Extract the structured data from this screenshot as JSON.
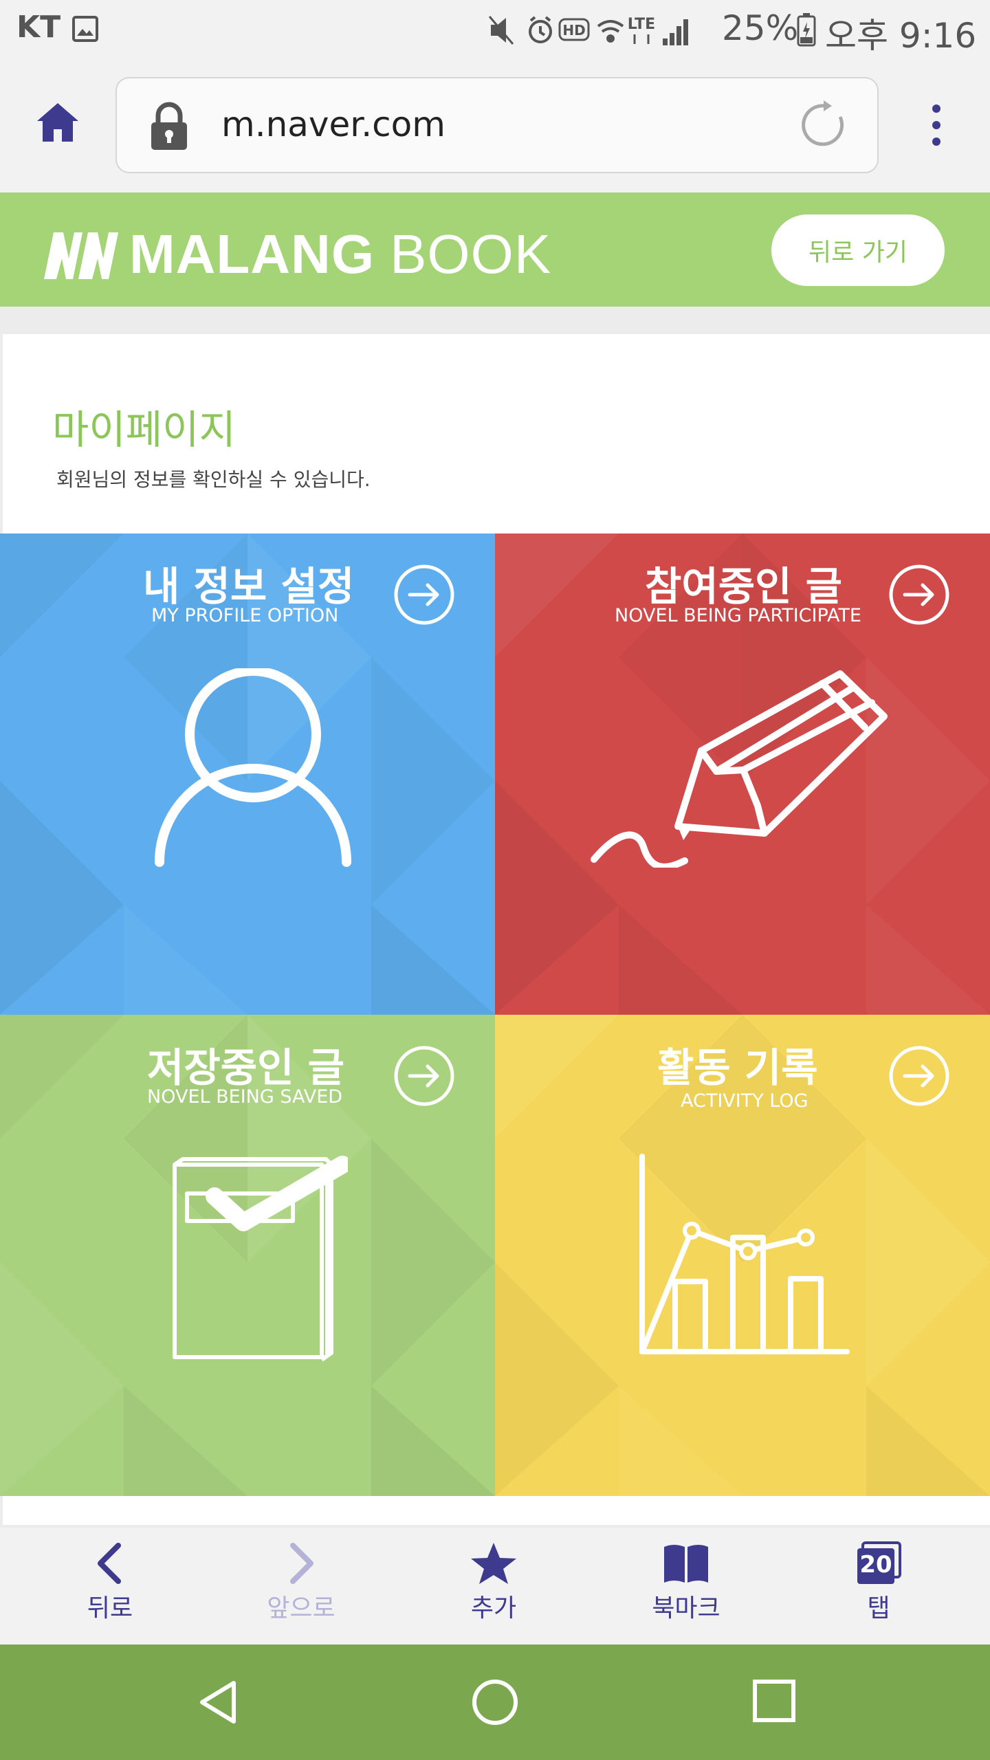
{
  "status_bar": {
    "carrier": "KT",
    "battery_percent": "25%",
    "time": "오후 9:16",
    "network": "LTE"
  },
  "browser": {
    "url": "m.naver.com",
    "icons": [
      "home-icon",
      "lock-icon",
      "reload-icon",
      "more-vert-icon"
    ]
  },
  "header": {
    "brand_bold": "MALANG",
    "brand_light": "BOOK",
    "back_label": "뒤로 가기",
    "color": "#a5d477"
  },
  "page": {
    "title": "마이페이지",
    "subtitle": "회원님의 정보를 확인하실 수 있습니다."
  },
  "tiles": [
    {
      "title": "내 정보 설정",
      "subtitle": "MY PROFILE OPTION",
      "color": "#5eaeef",
      "icon": "user-icon"
    },
    {
      "title": "참여중인 글",
      "subtitle": "NOVEL BEING PARTICIPATE",
      "color": "#d04a4a",
      "icon": "pencil-icon"
    },
    {
      "title": "저장중인 글",
      "subtitle": "NOVEL BEING SAVED",
      "color": "#a9d27e",
      "icon": "book-check-icon"
    },
    {
      "title": "활동 기록",
      "subtitle": "ACTIVITY LOG",
      "color": "#f4d75a",
      "icon": "chart-icon"
    }
  ],
  "toolbar": {
    "back": "뒤로",
    "forward": "앞으로",
    "add": "추가",
    "bookmarks": "북마크",
    "tabs": "탭",
    "tab_count": "20"
  }
}
